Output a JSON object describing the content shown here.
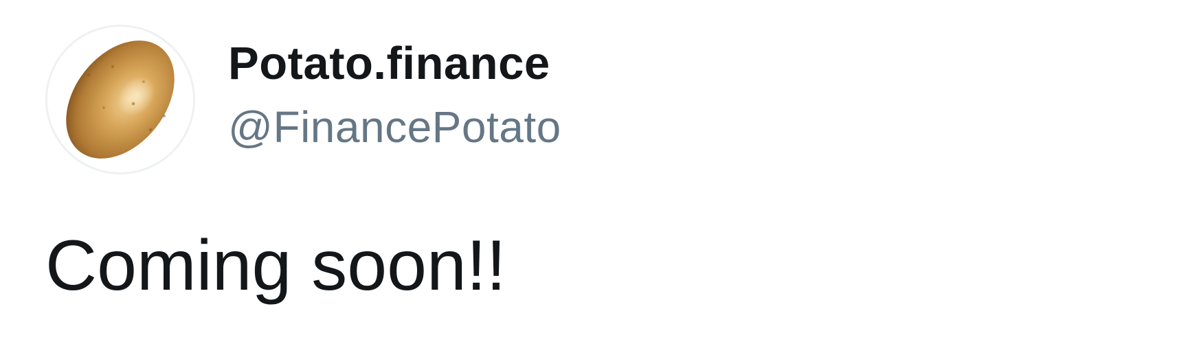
{
  "tweet": {
    "author": {
      "display_name": "Potato.finance",
      "handle": "@FinancePotato",
      "avatar_icon": "potato-icon"
    },
    "text": "Coming soon!!"
  },
  "colors": {
    "name": "#14171a",
    "handle": "#657786",
    "text": "#14171a",
    "avatar_border": "#eef1f3",
    "potato_light": "#e8c07a",
    "potato_dark": "#8a5a22"
  }
}
